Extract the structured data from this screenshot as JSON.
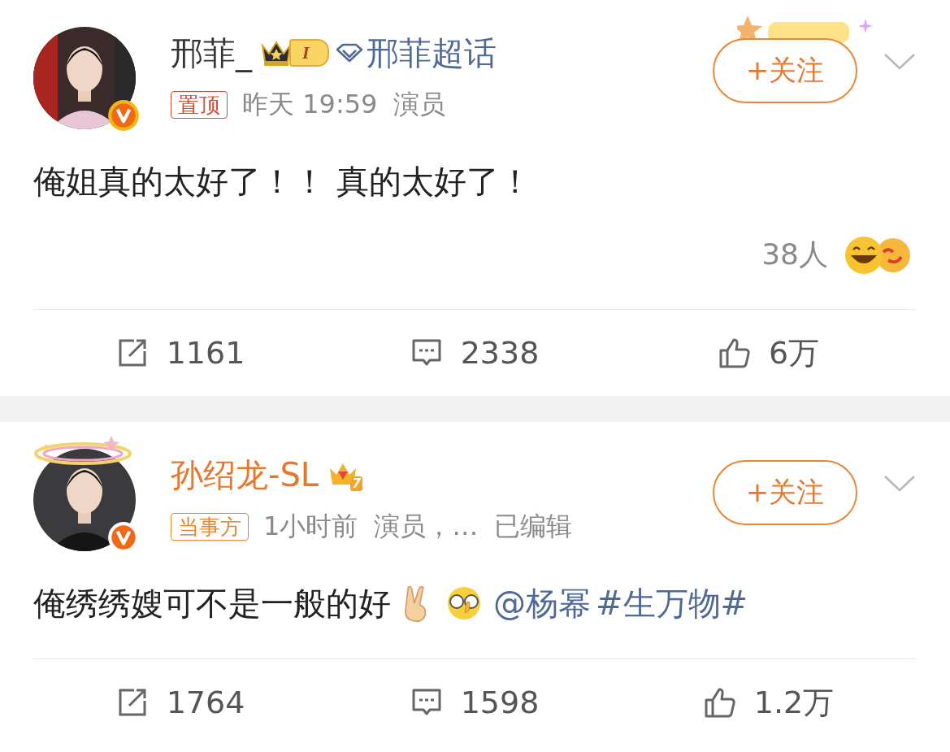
{
  "posts": [
    {
      "author": {
        "name": "邢菲_",
        "vip": false,
        "halo": false,
        "badge": {
          "kind": "crown-tag",
          "text": "I"
        },
        "supertopic": "邢菲超话"
      },
      "follow": "+关注",
      "sparkles": true,
      "tag": {
        "kind": "pinned",
        "text": "置顶"
      },
      "time": "昨天 19:59",
      "source": "演员",
      "body": [
        {
          "kind": "text",
          "text": "俺姐真的太好了！！ 真的太好了！"
        }
      ],
      "reactions": {
        "count": "38人"
      },
      "actions": [
        {
          "kind": "repost",
          "count": "1161"
        },
        {
          "kind": "comment",
          "count": "2338"
        },
        {
          "kind": "like",
          "count": "6万"
        }
      ]
    },
    {
      "author": {
        "name": "孙绍龙-SL",
        "vip": true,
        "halo": true,
        "badge": {
          "kind": "crown",
          "text": "7"
        }
      },
      "follow": "+关注",
      "sparkles": false,
      "tag": {
        "kind": "party",
        "text": "当事方"
      },
      "time": "1小时前",
      "source": "演员，…",
      "edited": "已编辑",
      "body": [
        {
          "kind": "text",
          "text": "俺绣绣嫂可不是一般的好"
        },
        {
          "kind": "victory-emoji"
        },
        {
          "kind": "glasses-emoji"
        },
        {
          "kind": "mention",
          "text": "@杨幂"
        },
        {
          "kind": "topic",
          "text": "#生万物#"
        }
      ],
      "actions": [
        {
          "kind": "repost",
          "count": "1764"
        },
        {
          "kind": "comment",
          "count": "1598"
        },
        {
          "kind": "like",
          "count": "1.2万"
        }
      ]
    }
  ]
}
